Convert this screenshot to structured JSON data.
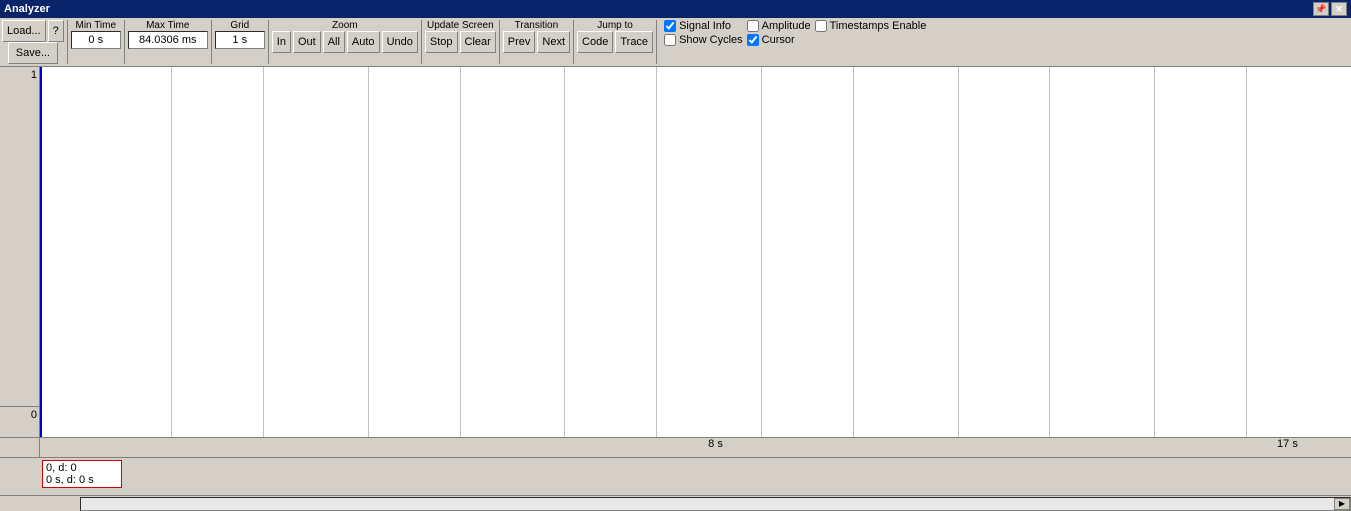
{
  "titleBar": {
    "title": "Analyzer",
    "pinButton": "📌",
    "closeButton": "✕"
  },
  "toolbar": {
    "loadButton": "Load...",
    "saveButton": "Save...",
    "helpButton": "?",
    "minTimeLabel": "Min Time",
    "minTimeValue": "0 s",
    "maxTimeLabel": "Max Time",
    "maxTimeValue": "84.0306 ms",
    "gridLabel": "Grid",
    "gridValue": "1 s",
    "zoomLabel": "Zoom",
    "zoomIn": "In",
    "zoomOut": "Out",
    "zoomAll": "All",
    "zoomAuto": "Auto",
    "zoomUndo": "Undo",
    "updateScreenLabel": "Update Screen",
    "stopButton": "Stop",
    "clearButton": "Clear",
    "transitionLabel": "Transition",
    "prevButton": "Prev",
    "nextButton": "Next",
    "jumpToLabel": "Jump to",
    "codeButton": "Code",
    "traceButton": "Trace",
    "signalInfoLabel": "Signal Info",
    "showCyclesLabel": "Show Cycles",
    "amplitudeLabel": "Amplitude",
    "cursorLabel": "Cursor",
    "timestampsLabel": "Timestamps Enable"
  },
  "signals": {
    "topValue": "1",
    "bottomValue": "0"
  },
  "timeRuler": {
    "label1": "8 s",
    "label1Pos": "50",
    "label2": "17 s",
    "label2Pos": "95"
  },
  "statusBar": {
    "line1": "0,   d: 0",
    "line2": "0 s,  d: 0 s"
  },
  "gridLines": [
    10,
    17,
    25,
    32,
    40,
    47,
    55,
    62,
    70,
    77,
    85,
    92
  ],
  "checkboxes": {
    "signalInfo": true,
    "showCycles": false,
    "amplitude": false,
    "cursor": true,
    "timestamps": false
  }
}
